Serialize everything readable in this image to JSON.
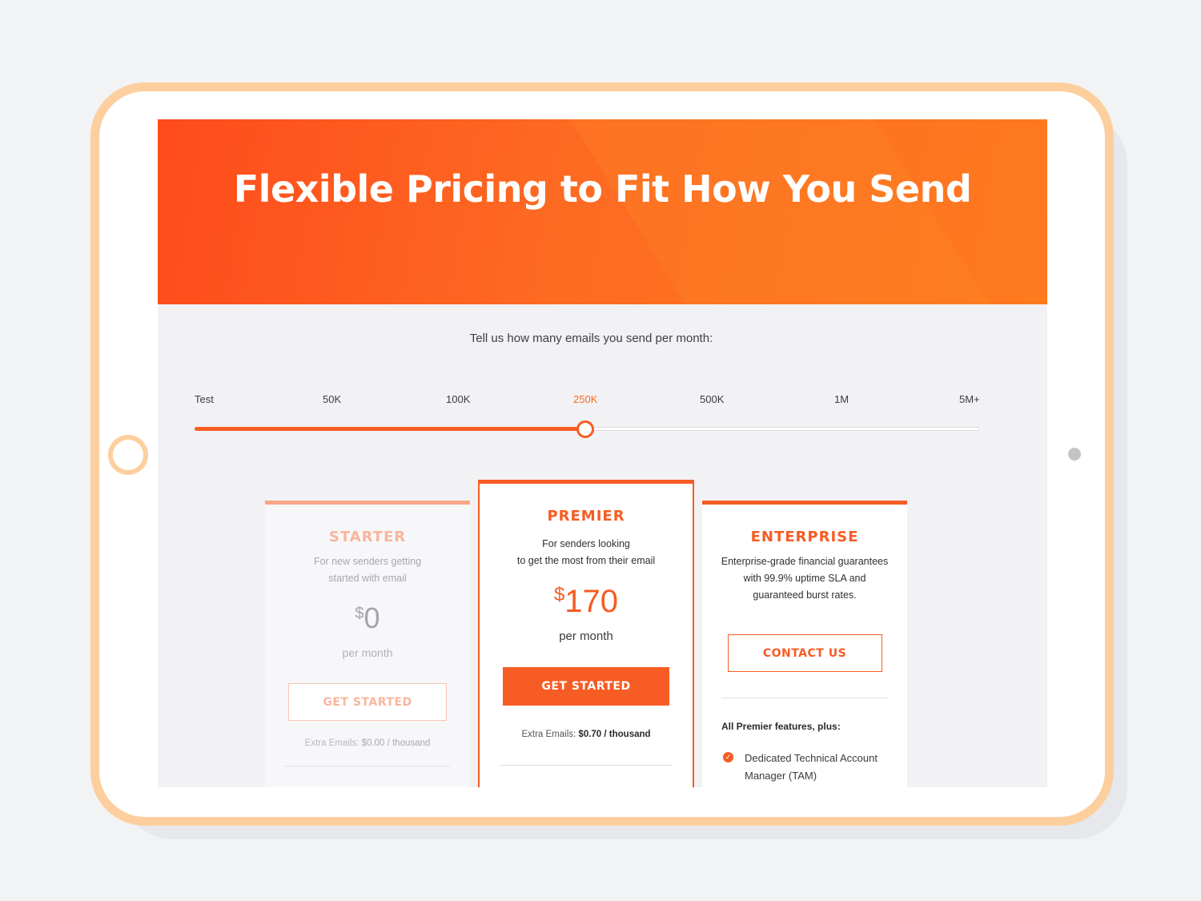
{
  "hero": {
    "title": "Flexible Pricing to Fit How You Send"
  },
  "slider": {
    "prompt": "Tell us how many emails you send per month:",
    "ticks": [
      "Test",
      "50K",
      "100K",
      "250K",
      "500K",
      "1M",
      "5M+"
    ],
    "selected": "250K",
    "selected_index": 3
  },
  "plans": {
    "starter": {
      "name": "STARTER",
      "desc_line1": "For new senders getting",
      "desc_line2": "started with email",
      "currency": "$",
      "price": "0",
      "period": "per month",
      "cta": "GET STARTED",
      "extra_label": "Extra Emails:",
      "extra_value": "$0.00 / thousand"
    },
    "premier": {
      "name": "PREMIER",
      "desc_line1": "For senders looking",
      "desc_line2": "to get the most from their email",
      "currency": "$",
      "price": "170",
      "period": "per month",
      "cta": "GET STARTED",
      "extra_label": "Extra Emails:",
      "extra_value": "$0.70 / thousand"
    },
    "enterprise": {
      "name": "ENTERPRISE",
      "desc_line1": "Enterprise-grade financial guarantees",
      "desc_line2": "with 99.9% uptime SLA and",
      "desc_line3": "guaranteed burst rates.",
      "cta": "CONTACT US",
      "features_heading": "All Premier features, plus:",
      "features": [
        "Dedicated Technical Account Manager (TAM)"
      ]
    }
  },
  "colors": {
    "accent": "#f65c23",
    "hero_start": "#fe4b1c",
    "hero_end": "#fe7a1e",
    "tablet_frame": "#fdcf9e"
  }
}
